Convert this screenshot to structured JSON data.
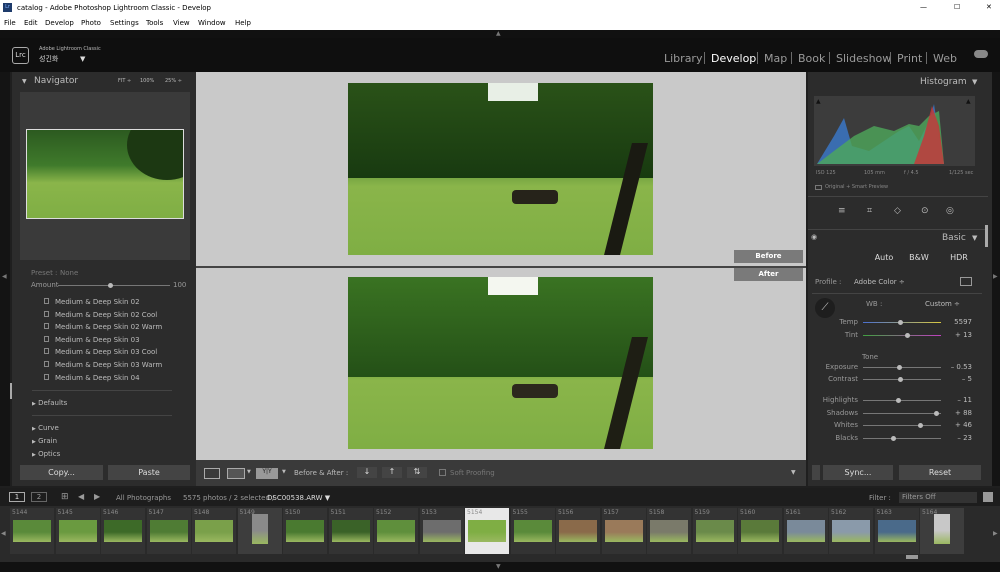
{
  "window": {
    "title": "catalog - Adobe Photoshop Lightroom Classic - Develop",
    "min": "—",
    "max": "☐",
    "close": "✕"
  },
  "menu": [
    "File",
    "Edit",
    "Develop",
    "Photo",
    "Settings",
    "Tools",
    "View",
    "Window",
    "Help"
  ],
  "identity": {
    "app": "Adobe Lightroom Classic",
    "user": "성긴화",
    "logo": "Lrc",
    "caret": "▼"
  },
  "modules": [
    "Library",
    "Develop",
    "Map",
    "Book",
    "Slideshow",
    "Print",
    "Web"
  ],
  "active_module": "Develop",
  "navigator": {
    "title": "Navigator",
    "opts": [
      "FIT ÷",
      "100%",
      "25% ÷"
    ]
  },
  "preset": {
    "label": "Preset :",
    "value": "None",
    "amount_label": "Amount",
    "amount_value": "100"
  },
  "presets": [
    "Medium & Deep Skin 02",
    "Medium & Deep Skin 02 Cool",
    "Medium & Deep Skin 02 Warm",
    "Medium & Deep Skin 03",
    "Medium & Deep Skin 03 Cool",
    "Medium & Deep Skin 03 Warm",
    "Medium & Deep Skin 04"
  ],
  "groups": [
    "Defaults",
    "Curve",
    "Grain",
    "Optics"
  ],
  "left_buttons": {
    "copy": "Copy...",
    "paste": "Paste"
  },
  "compare": {
    "before": "Before",
    "after": "After"
  },
  "toolbar": {
    "before_after": "Before & After :",
    "soft_proofing": "Soft Proofing",
    "ba_mode": "Y|Y"
  },
  "histogram": {
    "title": "Histogram",
    "iso": "ISO 125",
    "focal": "105 mm",
    "aperture": "f / 4.5",
    "shutter": "1/125 sec",
    "preview": "Original + Smart Preview"
  },
  "basic": {
    "title": "Basic",
    "auto": "Auto",
    "bw": "B&W",
    "hdr": "HDR",
    "profile_label": "Profile :",
    "profile_value": "Adobe Color ÷",
    "wb_label": "WB :",
    "wb_value": "Custom ÷",
    "tone_label": "Tone"
  },
  "sliders": [
    {
      "label": "Temp",
      "value": "5597",
      "pos": 0.48
    },
    {
      "label": "Tint",
      "value": "+ 13",
      "pos": 0.56
    },
    {
      "label": "Exposure",
      "value": "– 0.53",
      "pos": 0.46
    },
    {
      "label": "Contrast",
      "value": "– 5",
      "pos": 0.48
    },
    {
      "label": "Highlights",
      "value": "– 11",
      "pos": 0.45
    },
    {
      "label": "Shadows",
      "value": "+ 88",
      "pos": 0.94
    },
    {
      "label": "Whites",
      "value": "+ 46",
      "pos": 0.73
    },
    {
      "label": "Blacks",
      "value": "– 23",
      "pos": 0.39
    }
  ],
  "right_buttons": {
    "sync": "Sync...",
    "reset": "Reset"
  },
  "filmhdr": {
    "page1": "1",
    "page2": "2",
    "source": "All Photographs",
    "count": "5575 photos / 2 selected /",
    "file": "DSC00538.ARW ▼",
    "filter_label": "Filter :",
    "filter_value": "Filters Off"
  },
  "film": [
    "5144",
    "5145",
    "5146",
    "5147",
    "5148",
    "5149",
    "5150",
    "5151",
    "5152",
    "5153",
    "5154",
    "5155",
    "5156",
    "5157",
    "5158",
    "5159",
    "5160",
    "5161",
    "5162",
    "5163",
    "5164"
  ],
  "colors": {
    "accent": "#c9c9c9",
    "panel": "#2c2c2c"
  }
}
